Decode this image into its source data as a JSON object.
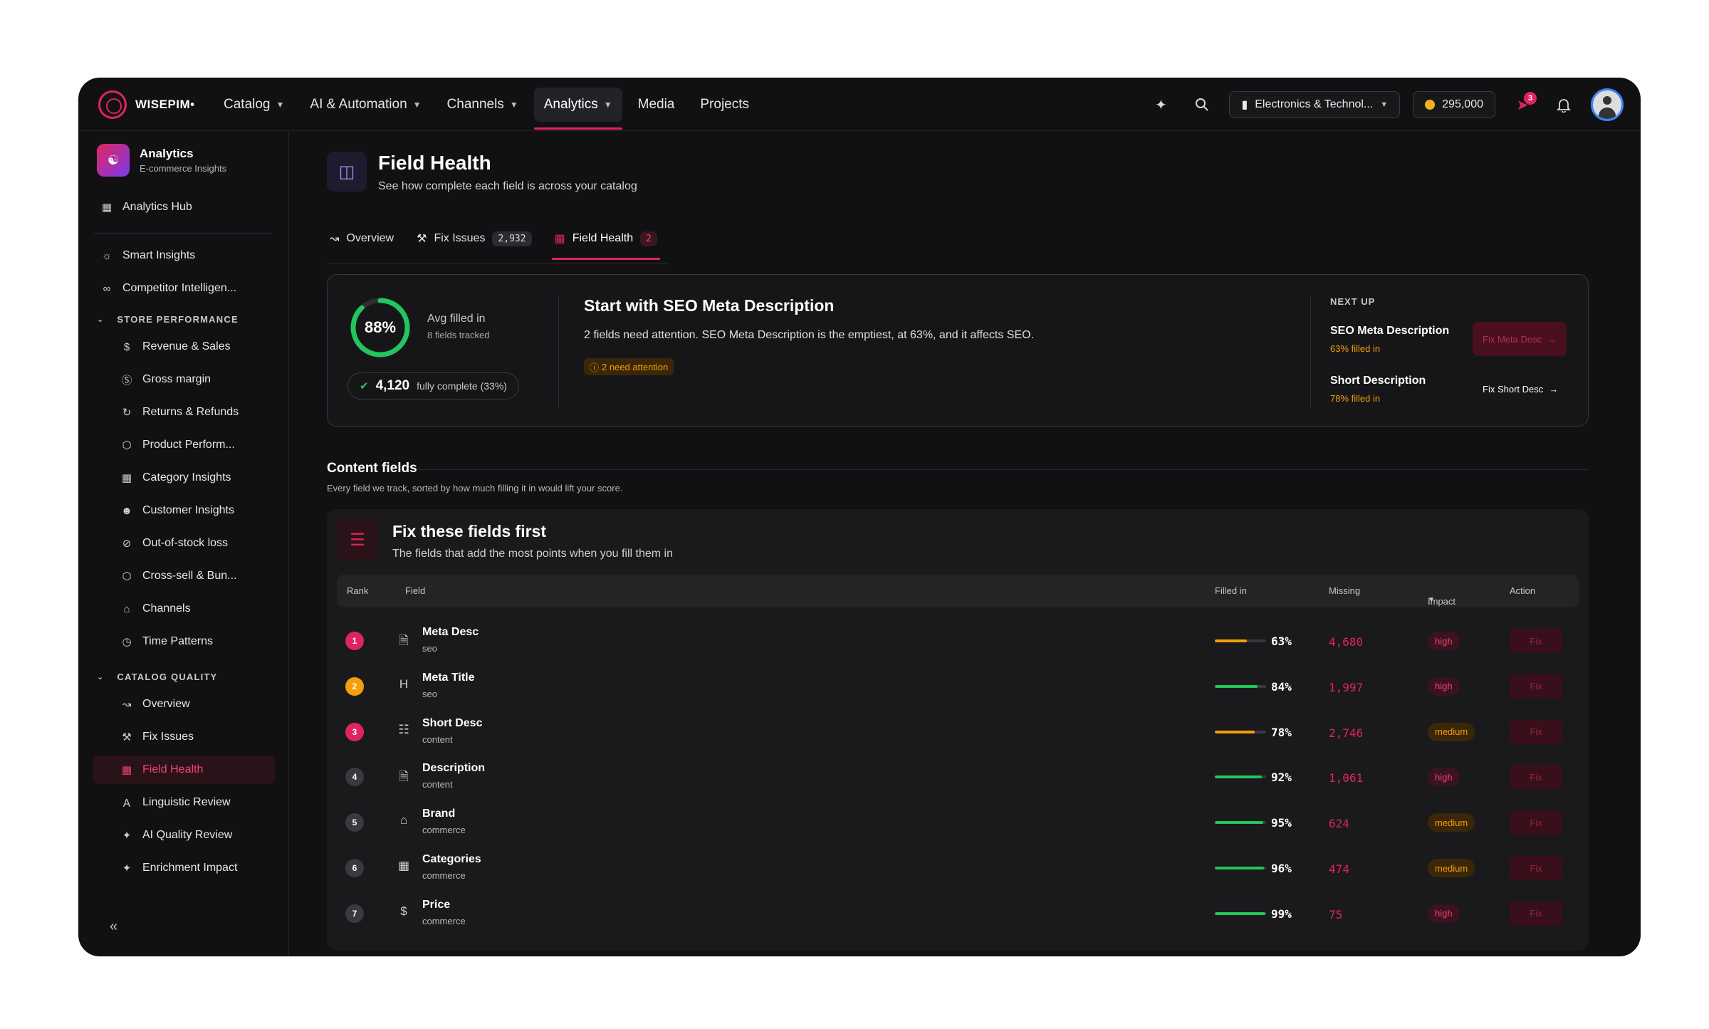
{
  "nav": {
    "brand": "WISEPIM•",
    "items": [
      {
        "label": "Catalog",
        "dropdown": true
      },
      {
        "label": "AI & Automation",
        "dropdown": true
      },
      {
        "label": "Channels",
        "dropdown": true
      },
      {
        "label": "Analytics",
        "dropdown": true,
        "active": true
      },
      {
        "label": "Media",
        "dropdown": false
      },
      {
        "label": "Projects",
        "dropdown": false
      }
    ],
    "workspace": "Electronics & Technol...",
    "credits": "295,000",
    "notification_count": "3"
  },
  "sidebar": {
    "title": "Analytics",
    "subtitle": "E-commerce Insights",
    "hub": "Analytics Hub",
    "top_items": [
      "Smart Insights",
      "Competitor Intelligen..."
    ],
    "store_section": "STORE PERFORMANCE",
    "store_items": [
      "Revenue & Sales",
      "Gross margin",
      "Returns & Refunds",
      "Product Perform...",
      "Category Insights",
      "Customer Insights",
      "Out-of-stock loss",
      "Cross-sell & Bun...",
      "Channels",
      "Time Patterns"
    ],
    "catalog_section": "CATALOG QUALITY",
    "catalog_items": [
      "Overview",
      "Fix Issues",
      "Field Health",
      "Linguistic Review",
      "AI Quality Review",
      "Enrichment Impact"
    ],
    "collapse": "«"
  },
  "page": {
    "title": "Field Health",
    "subtitle": "See how complete each field is across your catalog",
    "tabs": [
      {
        "label": "Overview",
        "count": ""
      },
      {
        "label": "Fix Issues",
        "count": "2,932"
      },
      {
        "label": "Field Health",
        "count": "2",
        "active": true
      }
    ]
  },
  "hero": {
    "avg_percent": "88%",
    "avg_fraction": 0.88,
    "avg_title": "Avg filled in",
    "avg_sub": "8 fields tracked",
    "complete_num": "4,120",
    "complete_label": "fully complete (33%)",
    "title": "Start with SEO Meta Description",
    "desc": "2 fields need attention. SEO Meta Description is the emptiest, at 63%, and it affects SEO.",
    "badge": "2 need attention",
    "next_up_label": "NEXT UP",
    "next_up": [
      {
        "name": "SEO Meta Description",
        "sub": "63% filled in",
        "action": "Fix Meta Desc"
      },
      {
        "name": "Short Description",
        "sub": "78% filled in",
        "action": "Fix Short Desc"
      }
    ]
  },
  "content": {
    "title": "Content fields",
    "subtitle": "Every field we track, sorted by how much filling it in would lift your score."
  },
  "panel": {
    "title": "Fix these fields first",
    "subtitle": "The fields that add the most points when you fill them in",
    "headers": {
      "rank": "Rank",
      "field": "Field",
      "filled": "Filled in",
      "missing": "Missing",
      "impact": "Impact",
      "action": "Action"
    },
    "rows": [
      {
        "rank": "1",
        "name": "Meta Desc",
        "group": "seo",
        "icon": "document-icon",
        "filled": "63%",
        "fill": 0.63,
        "missing": "4,680",
        "impact": "high",
        "action": "Fix",
        "rank_color": "#e0245e",
        "bar_color": "#f59e0b"
      },
      {
        "rank": "2",
        "name": "Meta Title",
        "group": "seo",
        "icon": "heading-icon",
        "filled": "84%",
        "fill": 0.84,
        "missing": "1,997",
        "impact": "high",
        "action": "Fix",
        "rank_color": "#f59e0b",
        "bar_color": "#22c55e"
      },
      {
        "rank": "3",
        "name": "Short Desc",
        "group": "content",
        "icon": "text-doc-icon",
        "filled": "78%",
        "fill": 0.78,
        "missing": "2,746",
        "impact": "medium",
        "action": "Fix",
        "rank_color": "#e0245e",
        "bar_color": "#f59e0b"
      },
      {
        "rank": "4",
        "name": "Description",
        "group": "content",
        "icon": "document-icon",
        "filled": "92%",
        "fill": 0.92,
        "missing": "1,061",
        "impact": "high",
        "action": "Fix",
        "rank_color": "#3a3a3e",
        "bar_color": "#22c55e"
      },
      {
        "rank": "5",
        "name": "Brand",
        "group": "commerce",
        "icon": "store-icon",
        "filled": "95%",
        "fill": 0.95,
        "missing": "624",
        "impact": "medium",
        "action": "Fix",
        "rank_color": "#3a3a3e",
        "bar_color": "#22c55e"
      },
      {
        "rank": "6",
        "name": "Categories",
        "group": "commerce",
        "icon": "grid-icon",
        "filled": "96%",
        "fill": 0.96,
        "missing": "474",
        "impact": "medium",
        "action": "Fix",
        "rank_color": "#3a3a3e",
        "bar_color": "#22c55e"
      },
      {
        "rank": "7",
        "name": "Price",
        "group": "commerce",
        "icon": "dollar-icon",
        "filled": "99%",
        "fill": 0.99,
        "missing": "75",
        "impact": "high",
        "action": "Fix",
        "rank_color": "#3a3a3e",
        "bar_color": "#22c55e"
      }
    ]
  },
  "colors": {
    "accent": "#e0245e",
    "ring": "#22c55e",
    "warning": "#f59e0b"
  }
}
